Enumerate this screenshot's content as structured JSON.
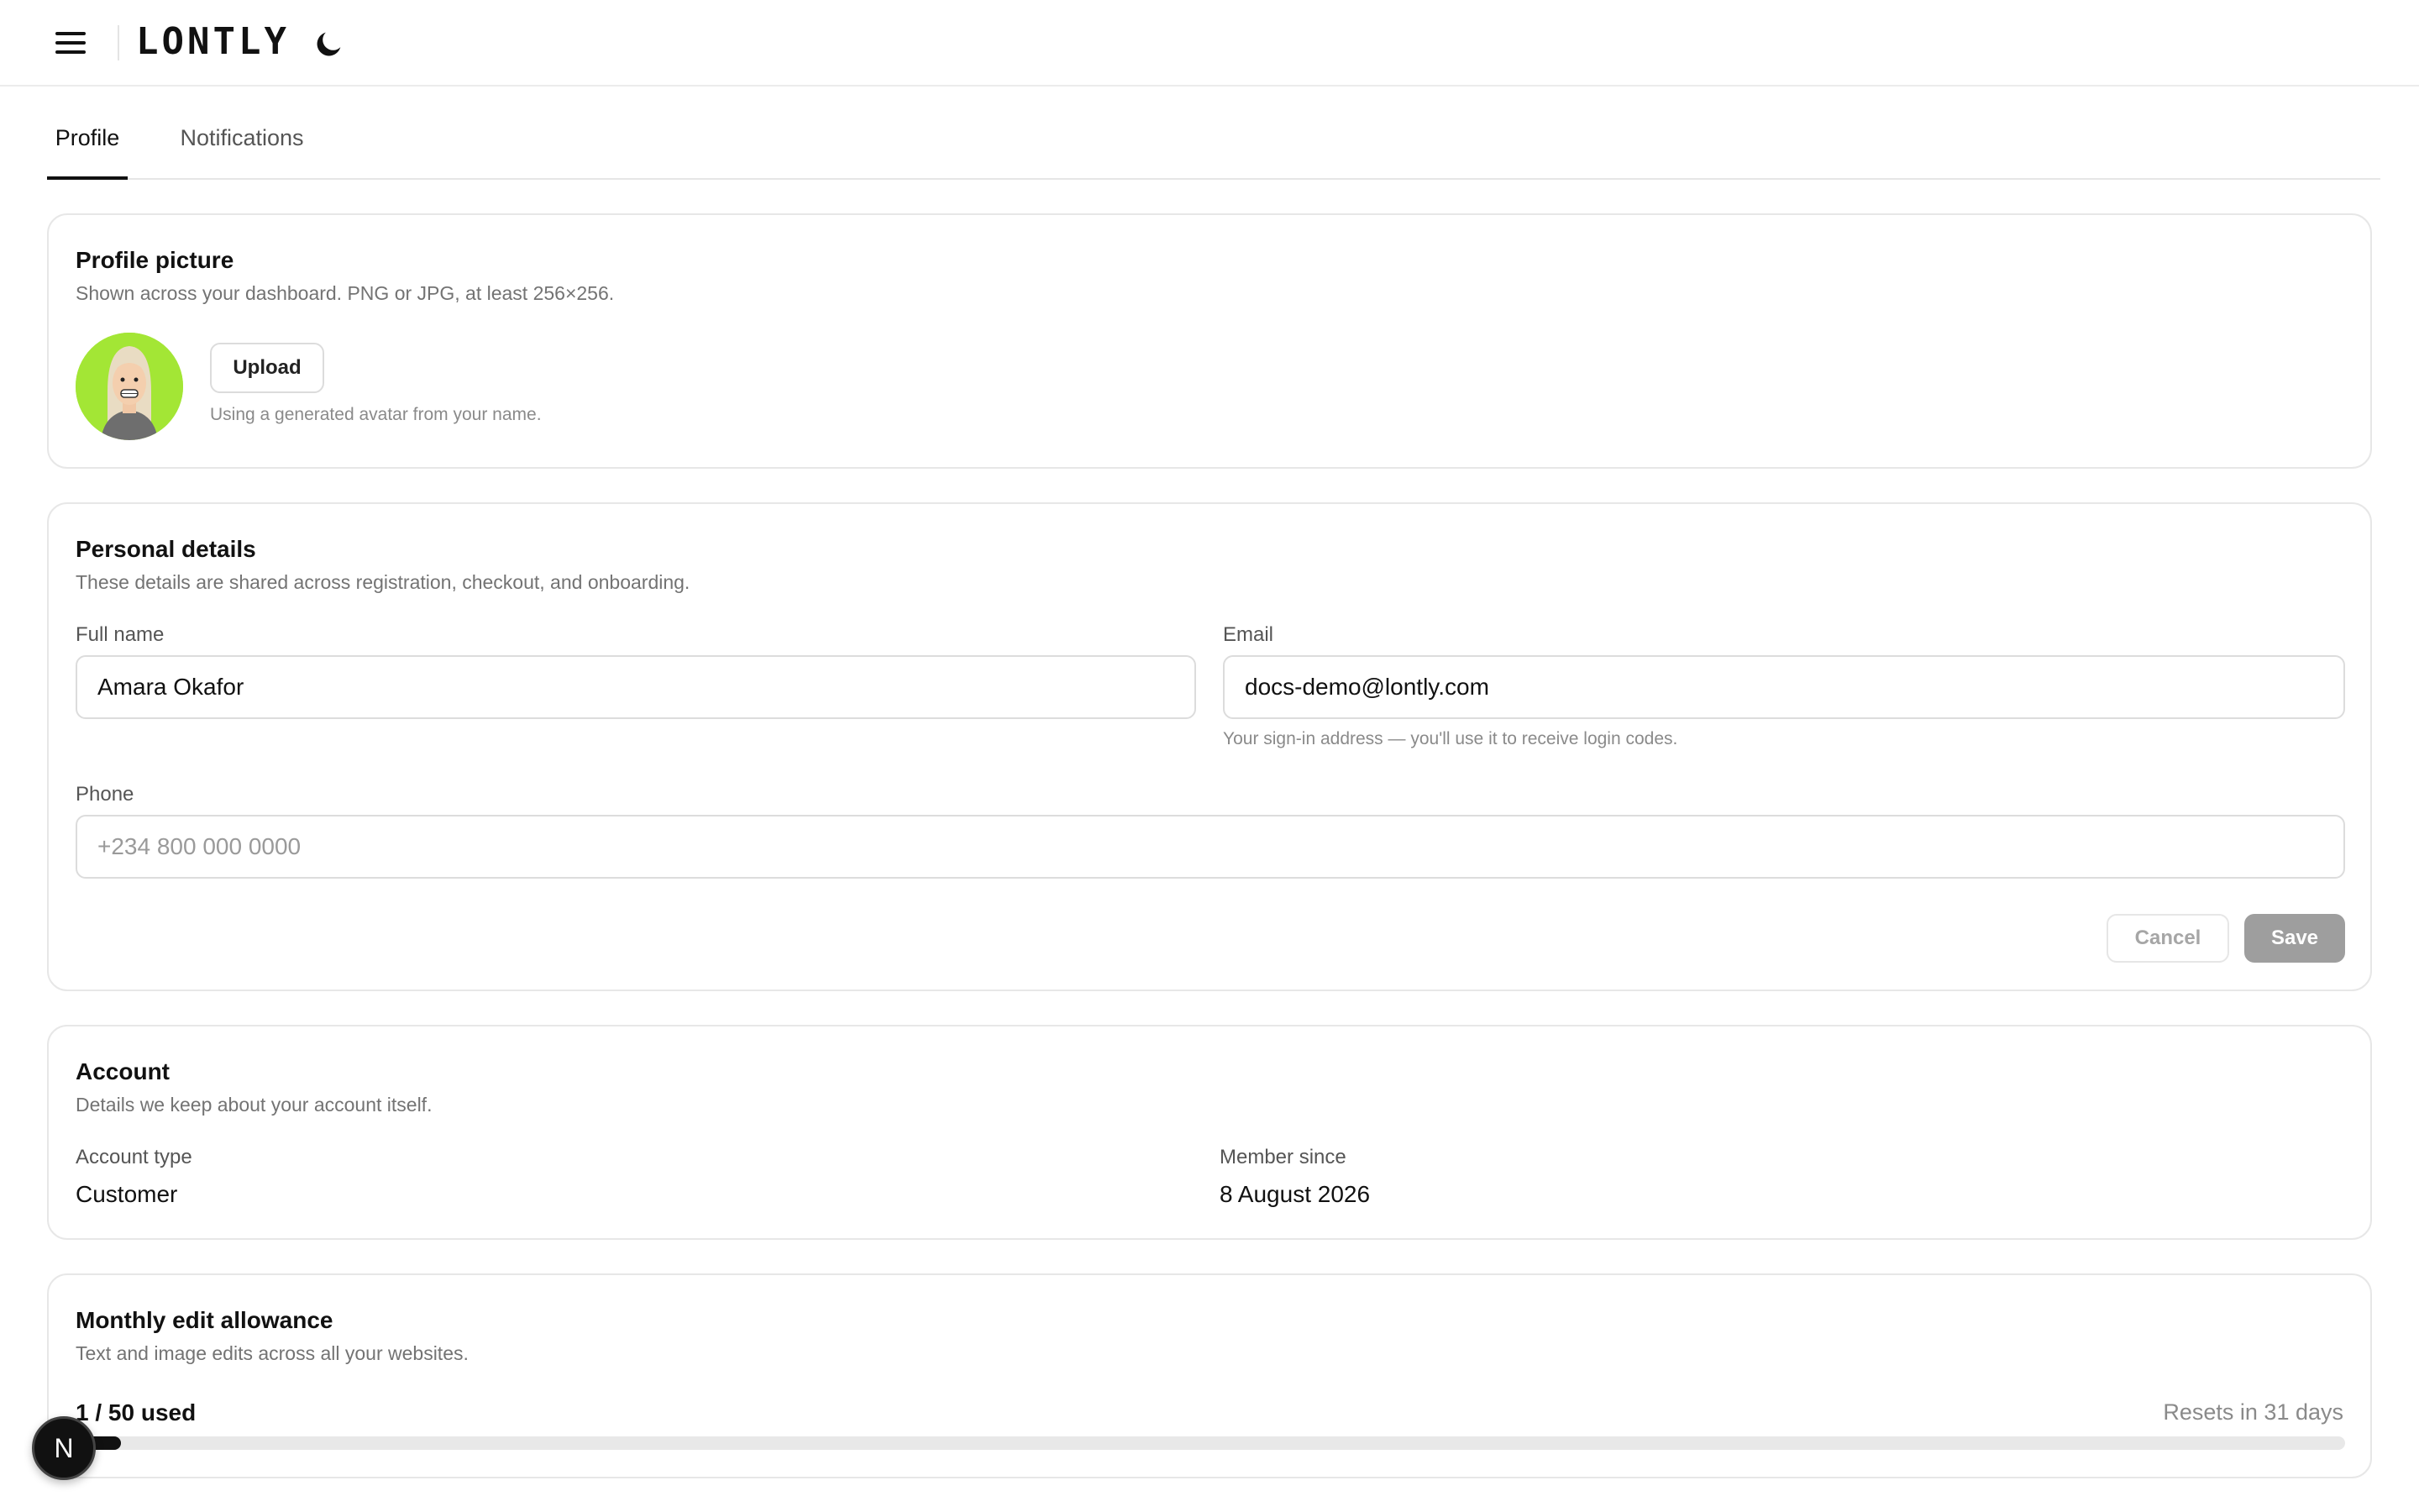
{
  "header": {
    "logo": "LONTLY",
    "menu_icon": "hamburger-menu-icon",
    "theme_icon": "moon-icon"
  },
  "tabs": [
    {
      "label": "Profile",
      "active": true
    },
    {
      "label": "Notifications",
      "active": false
    }
  ],
  "profile_picture": {
    "title": "Profile picture",
    "subtitle": "Shown across your dashboard. PNG or JPG, at least 256×256.",
    "upload_label": "Upload",
    "hint": "Using a generated avatar from your name.",
    "avatar_bg": "#a3e635"
  },
  "personal": {
    "title": "Personal details",
    "subtitle": "These details are shared across registration, checkout, and onboarding.",
    "full_name_label": "Full name",
    "full_name_value": "Amara Okafor",
    "email_label": "Email",
    "email_value": "docs-demo@lontly.com",
    "email_hint": "Your sign-in address — you'll use it to receive login codes.",
    "phone_label": "Phone",
    "phone_placeholder": "+234 800 000 0000",
    "cancel_label": "Cancel",
    "save_label": "Save"
  },
  "account": {
    "title": "Account",
    "subtitle": "Details we keep about your account itself.",
    "type_label": "Account type",
    "type_value": "Customer",
    "since_label": "Member since",
    "since_value": "8 August 2026"
  },
  "allowance": {
    "title": "Monthly edit allowance",
    "subtitle": "Text and image edits across all your websites.",
    "usage": "1 / 50 used",
    "used": 1,
    "total": 50,
    "resets": "Resets in 31 days"
  },
  "floating_badge": {
    "letter": "N"
  }
}
